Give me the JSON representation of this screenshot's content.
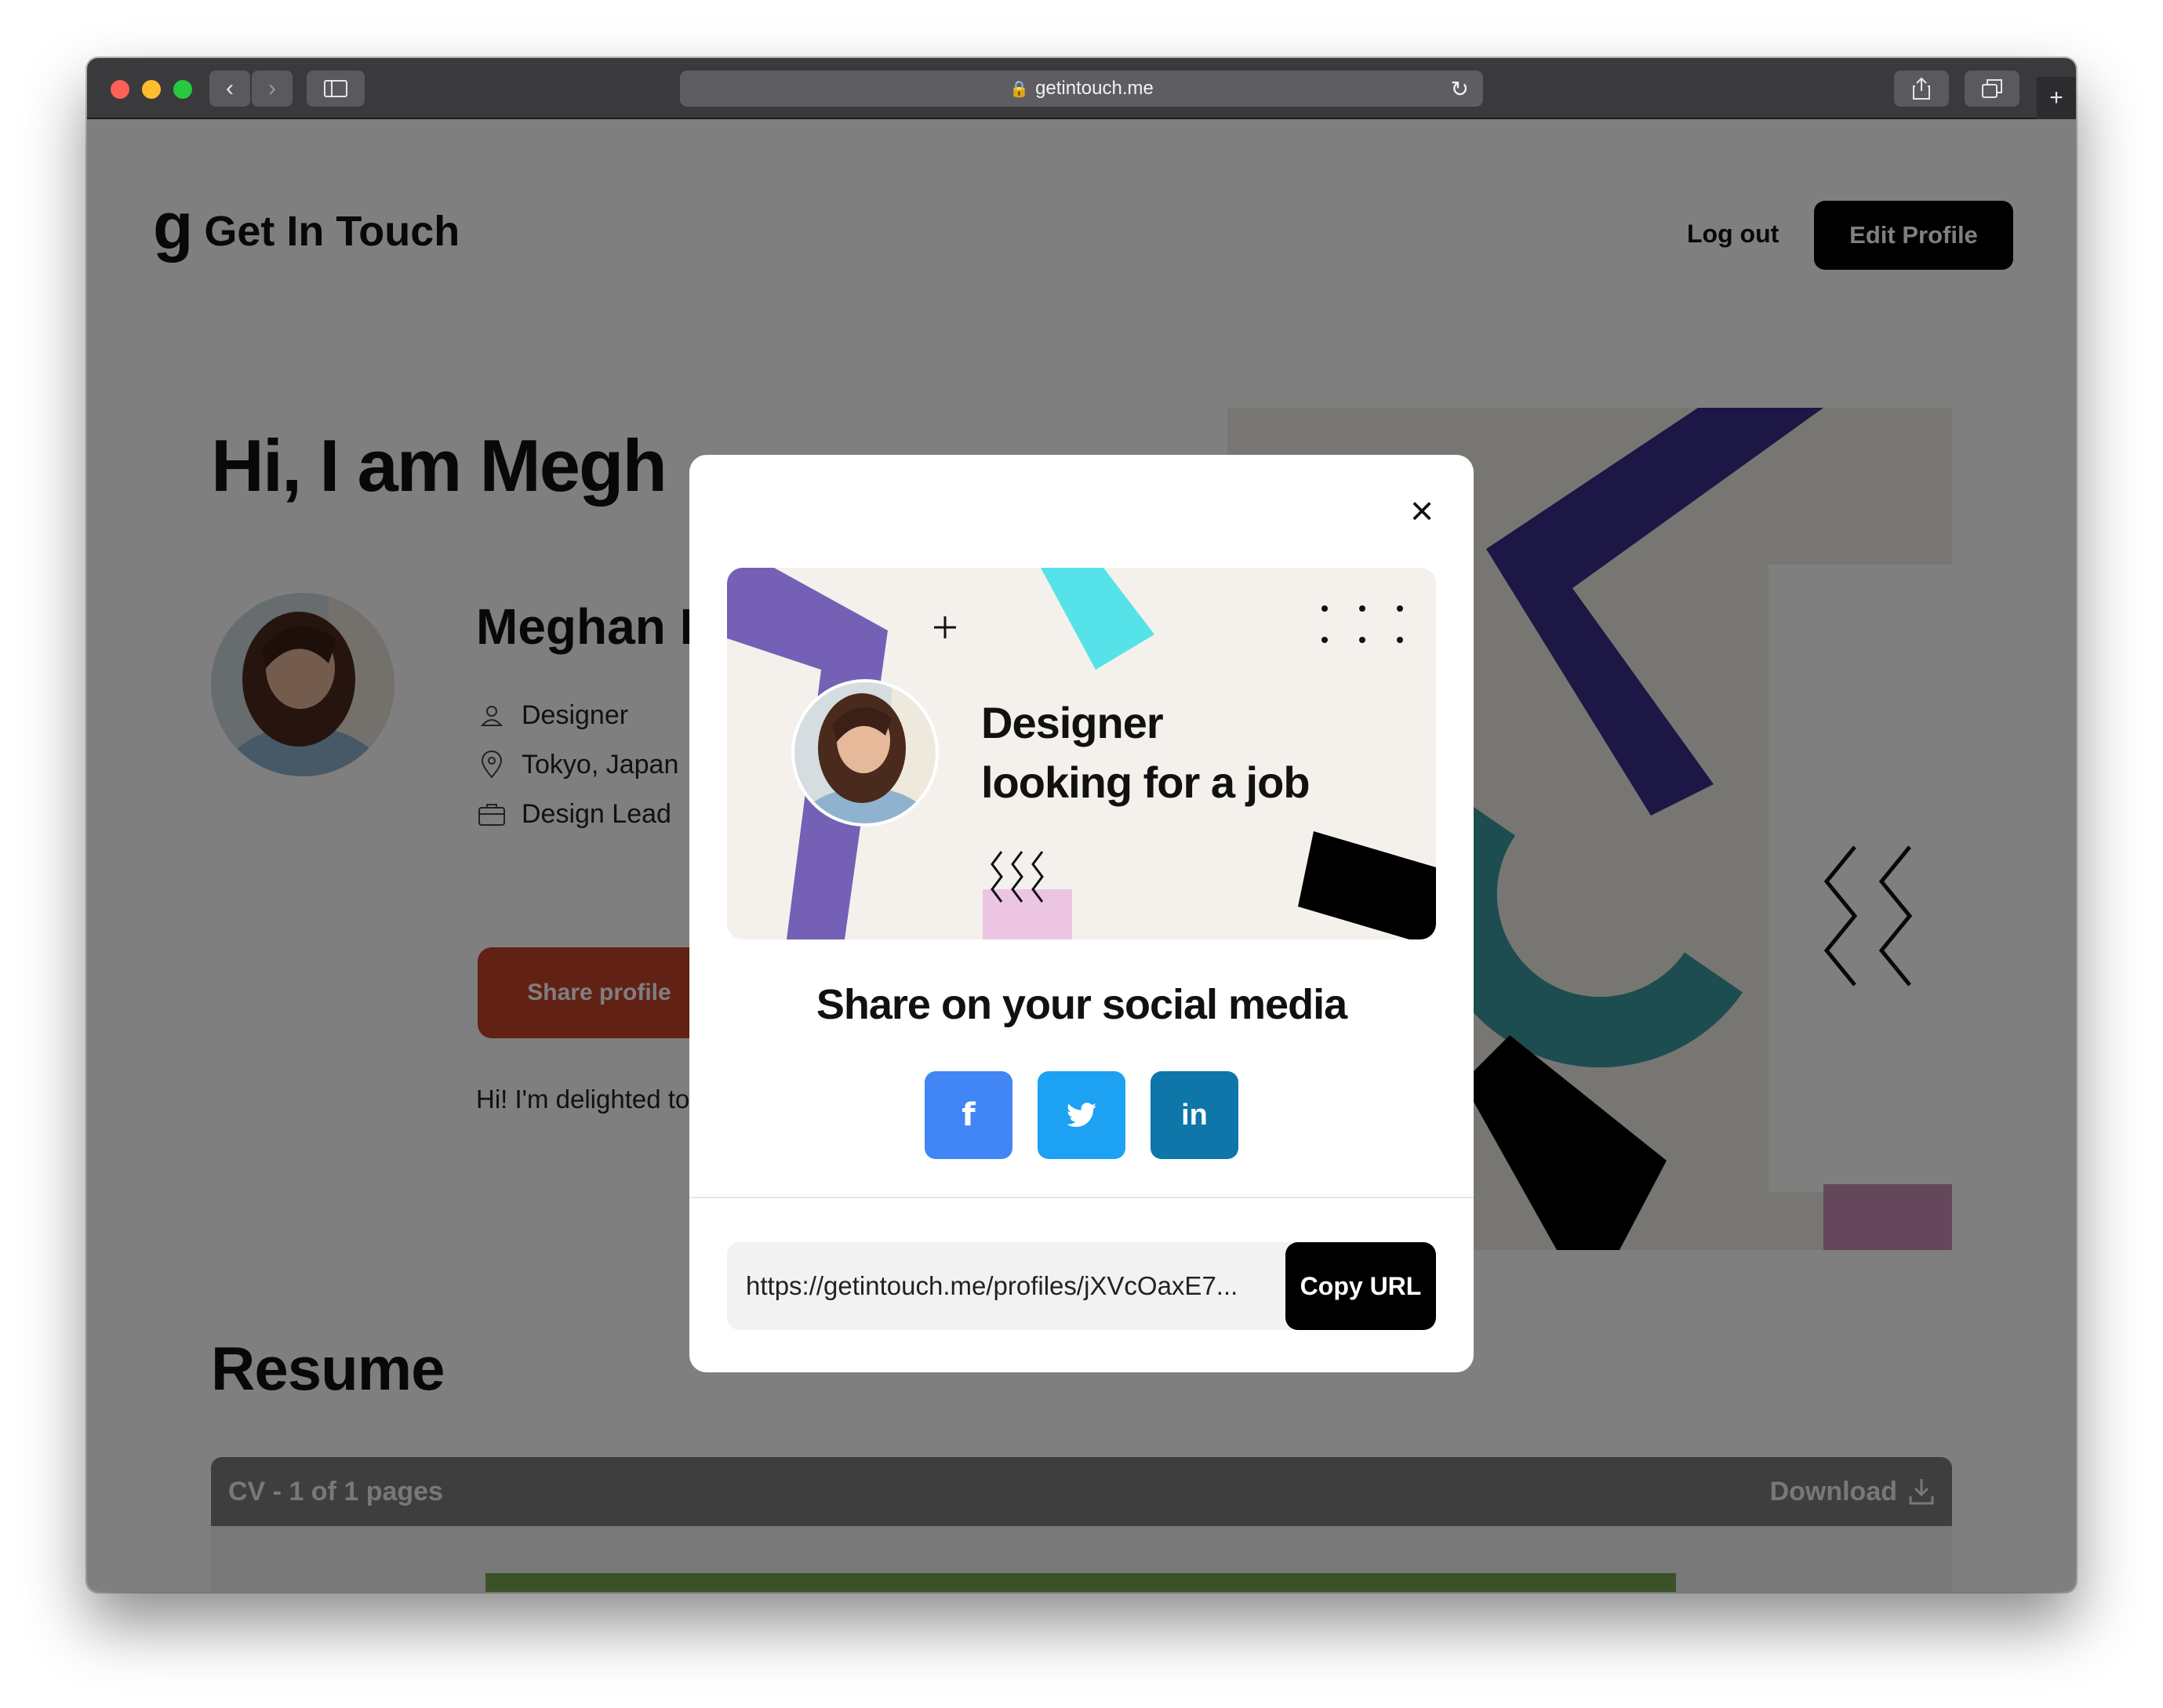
{
  "browser": {
    "url": "getintouch.me",
    "lights": {
      "close": "#fe5f57",
      "minimize": "#febc2e",
      "zoom": "#28c840"
    }
  },
  "header": {
    "logo_mark": "g",
    "logo_text": "Get In Touch",
    "logout_label": "Log out",
    "edit_profile_label": "Edit Profile"
  },
  "profile": {
    "greeting": "Hi, I am Megh",
    "name": "Meghan I",
    "role": "Designer",
    "location": "Tokyo, Japan",
    "job": "Design Lead",
    "share_label": "Share profile",
    "bio": "Hi! I'm delighted to to all of you!"
  },
  "resume": {
    "title": "Resume",
    "viewer_label": "CV - 1 of 1 pages",
    "download_label": "Download"
  },
  "modal": {
    "banner_line1": "Designer",
    "banner_line2": "looking for a job",
    "title": "Share on your social media",
    "facebook_label": "f",
    "twitter_label": "twitter",
    "linkedin_label": "in",
    "url_value": "https://getintouch.me/profiles/jXVcOaxE7...",
    "copy_label": "Copy URL"
  },
  "colors": {
    "accent_share": "#c24328",
    "facebook": "#4285f4",
    "twitter": "#1da1f2",
    "linkedin": "#0e76a8",
    "banner_purple": "#7461b5",
    "banner_cyan": "#56e2e9",
    "banner_pink": "#ecc5e3"
  }
}
